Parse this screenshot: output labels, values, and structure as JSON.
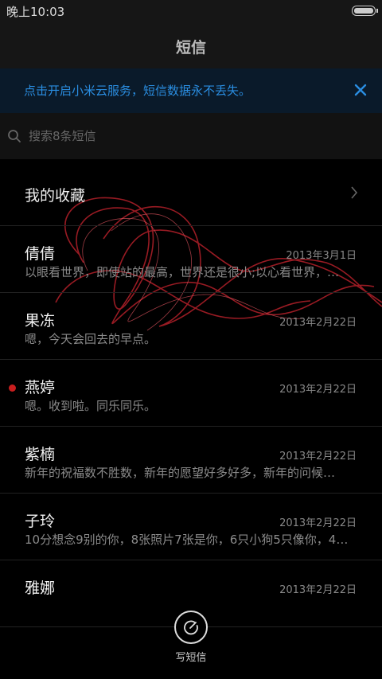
{
  "status_bar": {
    "time": "晚上10:03"
  },
  "header": {
    "title": "短信"
  },
  "banner": {
    "text": "点击开启小米云服务，短信数据永不丢失。"
  },
  "search": {
    "placeholder": "搜索8条短信"
  },
  "favorites": {
    "label": "我的收藏"
  },
  "messages": [
    {
      "name": "倩倩",
      "date": "2013年3月1日",
      "preview": "以眼看世界，即使站的最高，世界还是很小;以心看世界，…",
      "unread": false
    },
    {
      "name": "果冻",
      "date": "2013年2月22日",
      "preview": "嗯，今天会回去的早点。",
      "unread": false
    },
    {
      "name": "燕婷",
      "date": "2013年2月22日",
      "preview": "嗯。收到啦。同乐同乐。",
      "unread": true
    },
    {
      "name": "紫楠",
      "date": "2013年2月22日",
      "preview": "新年的祝福数不胜数，新年的愿望好多好多，新年的问候…",
      "unread": false
    },
    {
      "name": "子玲",
      "date": "2013年2月22日",
      "preview": "10分想念9别的你，8张照片7张是你，6只小狗5只像你，4…",
      "unread": false
    },
    {
      "name": "雅娜",
      "date": "2013年2月22日",
      "preview": "",
      "unread": false
    }
  ],
  "compose": {
    "label": "写短信"
  },
  "colors": {
    "accent": "#2a8de0",
    "unread": "#c81e1e",
    "background": "#000000"
  }
}
